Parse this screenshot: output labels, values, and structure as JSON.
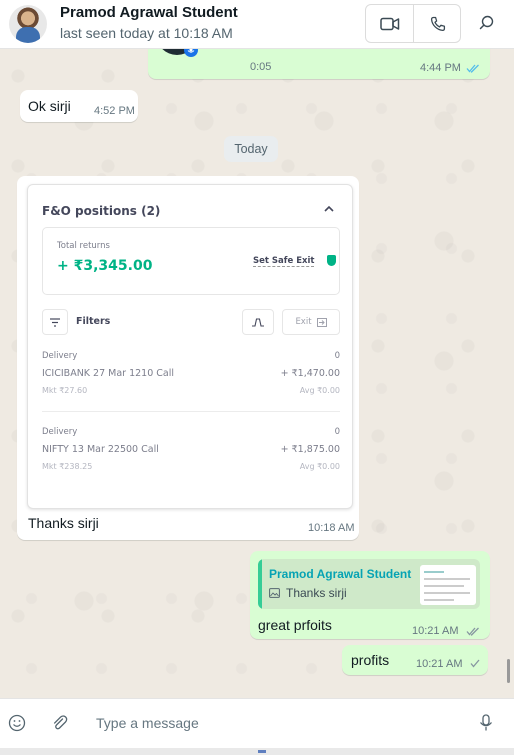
{
  "header": {
    "contact_name": "Pramod Agrawal Student",
    "status": "last seen today at 10:18 AM",
    "video_icon": "video-call-icon",
    "voice_icon": "phone-icon",
    "search_icon": "search-icon"
  },
  "messages": {
    "voice": {
      "duration": "0:05",
      "time": "4:44 PM",
      "status": "read"
    },
    "ok": {
      "text": "Ok sirji",
      "time": "4:52 PM"
    },
    "date_separator": "Today",
    "image_message": {
      "caption": "Thanks sirji",
      "time": "10:18 AM",
      "screenshot": {
        "title": "F&O positions (2)",
        "total_returns_label": "Total returns",
        "total_returns_value": "+ ₹3,345.00",
        "safe_exit_label": "Set Safe Exit",
        "filters_label": "Filters",
        "exit_label": "Exit",
        "positions": [
          {
            "type": "Delivery",
            "qty": "0",
            "name": "ICICIBANK 27 Mar 1210 Call",
            "pnl": "+ ₹1,470.00",
            "mkt": "Mkt ₹27.60",
            "avg": "Avg ₹0.00"
          },
          {
            "type": "Delivery",
            "qty": "0",
            "name": "NIFTY 13 Mar 22500 Call",
            "pnl": "+ ₹1,875.00",
            "mkt": "Mkt ₹238.25",
            "avg": "Avg ₹0.00"
          }
        ]
      }
    },
    "reply": {
      "quoted_name": "Pramod Agrawal Student",
      "quoted_text": "Thanks sirji",
      "text": "great prfoits",
      "time": "10:21 AM",
      "status": "read"
    },
    "profits": {
      "text": "profits",
      "time": "10:21 AM",
      "status": "sent"
    }
  },
  "footer": {
    "placeholder": "Type a message",
    "emoji_icon": "emoji-icon",
    "attach_icon": "paperclip-icon",
    "mic_icon": "microphone-icon"
  },
  "colors": {
    "chat_bg": "#efeae2",
    "outgoing": "#d9fdd3",
    "incoming": "#ffffff",
    "read_tick": "#53bdeb",
    "gain_green": "#00b386"
  }
}
